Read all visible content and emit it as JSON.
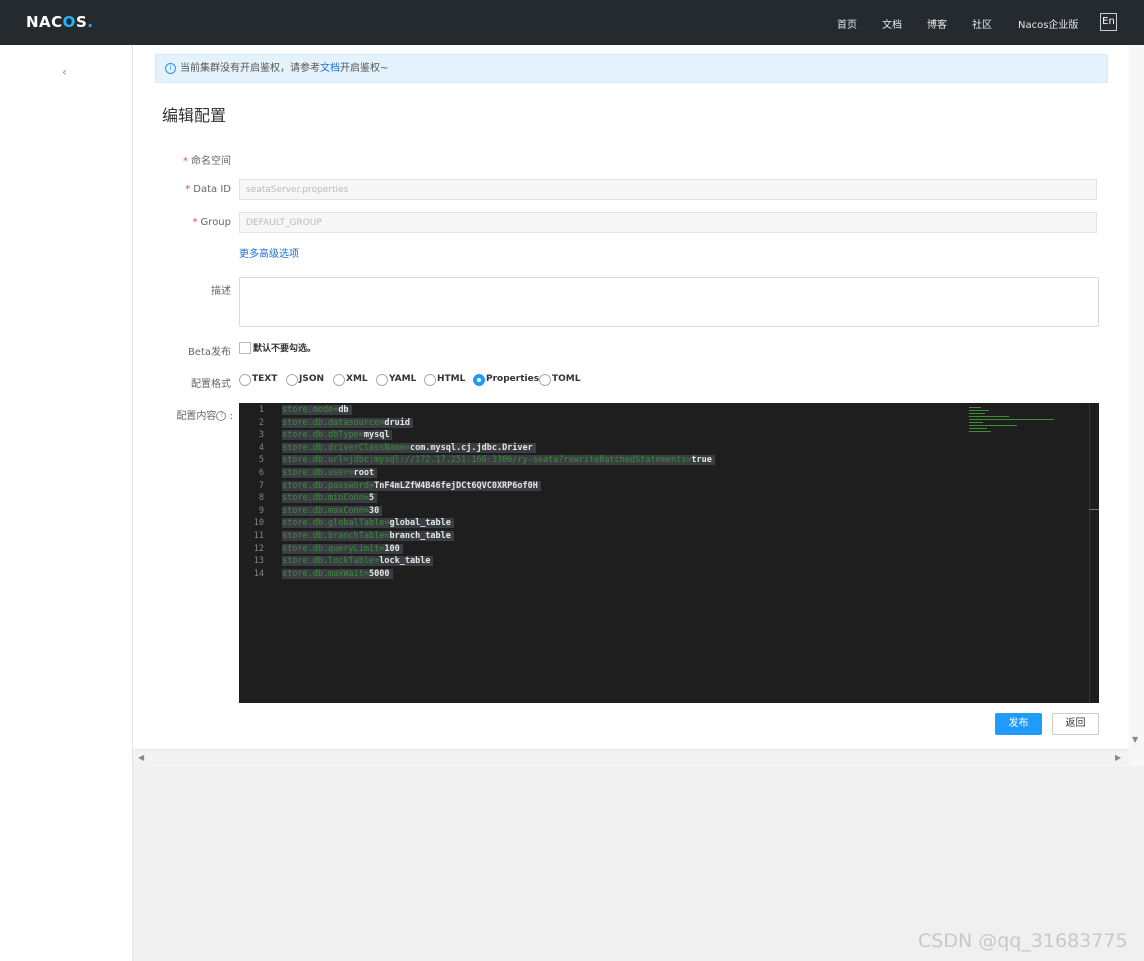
{
  "header": {
    "logo": {
      "prefix": "NAC",
      "highlight": "O",
      "suffix": "S",
      "dot": "."
    },
    "nav": [
      "首页",
      "文档",
      "博客",
      "社区",
      "Nacos企业版"
    ],
    "language_button": "En"
  },
  "sidebar": {
    "collapse_icon": "chevron-left-icon",
    "collapse_glyph": "‹"
  },
  "notice": {
    "icon": "info-icon",
    "text_before": "当前集群没有开启鉴权，请参考",
    "link": "文档",
    "text_after": "开启鉴权~"
  },
  "page_title": "编辑配置",
  "form": {
    "namespace_label": "命名空间",
    "dataid_label": "Data ID",
    "dataid_value": "seataServer.properties",
    "group_label": "Group",
    "group_value": "DEFAULT_GROUP",
    "advanced_link": "更多高级选项",
    "description_label": "描述",
    "description_value": "",
    "beta_label": "Beta发布",
    "beta_checkbox_label": "默认不要勾选。",
    "beta_checked": false,
    "format_label": "配置格式",
    "formats": [
      "TEXT",
      "JSON",
      "XML",
      "YAML",
      "HTML",
      "Properties",
      "TOML"
    ],
    "selected_format": "Properties",
    "content_label": "配置内容",
    "help_icon": "question-circle-icon"
  },
  "editor": {
    "lines": [
      {
        "n": "1",
        "key": "store.mode",
        "value": "db"
      },
      {
        "n": "2",
        "key": "store.db.datasource",
        "value": "druid"
      },
      {
        "n": "3",
        "key": "store.db.dbType",
        "value": "mysql"
      },
      {
        "n": "4",
        "key": "store.db.driverClassName",
        "value": "com.mysql.cj.jdbc.Driver"
      },
      {
        "n": "5",
        "key": "store.db.url",
        "value_faded": "jdbc:mysql://172.17.251.166:3306/ry-seata?rewriteBatchedStatements=",
        "value": "true"
      },
      {
        "n": "6",
        "key": "store.db.user",
        "value": "root"
      },
      {
        "n": "7",
        "key": "store.db.password",
        "value": "TnF4mLZfW4B46fejDCt6QVC0XRP6of0H"
      },
      {
        "n": "8",
        "key": "store.db.minConn",
        "value": "5"
      },
      {
        "n": "9",
        "key": "store.db.maxConn",
        "value": "30"
      },
      {
        "n": "10",
        "key": "store.db.globalTable",
        "value": "global_table"
      },
      {
        "n": "11",
        "key": "store.db.branchTable",
        "value": "branch_table"
      },
      {
        "n": "12",
        "key": "store.db.queryLimit",
        "value": "100"
      },
      {
        "n": "13",
        "key": "store.db.lockTable",
        "value": "lock_table"
      },
      {
        "n": "14",
        "key": "store.db.maxWait",
        "value": "5000"
      }
    ]
  },
  "actions": {
    "publish": "发布",
    "back": "返回"
  },
  "watermark": "CSDN @qq_31683775",
  "colors": {
    "header_bg": "#252a2f",
    "primary": "#209bfa",
    "notice_bg": "#e3f2fd",
    "editor_bg": "#1e1e1e",
    "key_color": "#3c8d3c"
  }
}
